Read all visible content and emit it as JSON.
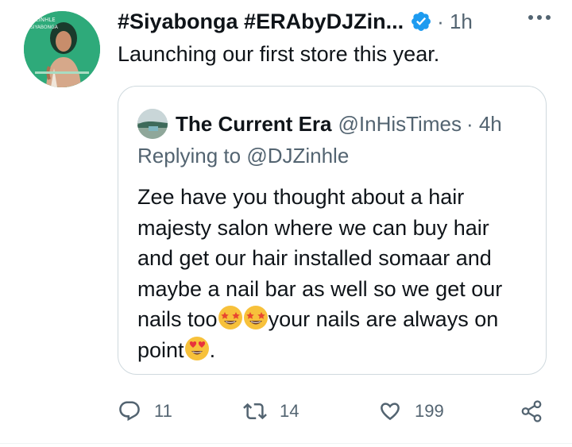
{
  "author": {
    "display_name": "#Siyabonga #ERAbyDJZin...",
    "time": "· 1h",
    "avatar_text_top": "ZINHLE",
    "avatar_text_sub": "SIYABONGA"
  },
  "tweet": {
    "text": "Launching our first store this year."
  },
  "quoted": {
    "display_name": "The Current Era",
    "handle": "@InHisTimes",
    "time": "· 4h",
    "replying_label": "Replying to",
    "replying_to": "@DJZinhle",
    "lines": [
      "Zee have you thought about a hair",
      "majesty salon where we can buy hair",
      "and get our hair installed somaar and",
      "maybe a nail bar as well so we get our"
    ],
    "line5_a": "nails too",
    "line5_b": "your nails are always on",
    "line6_a": "point",
    "line6_b": "."
  },
  "actions": {
    "replies": "11",
    "retweets": "14",
    "likes": "199"
  },
  "colors": {
    "verified": "#1d9bf0",
    "muted": "#536471",
    "border": "#cfd9de",
    "avatar_bg": "#2eaa7a"
  },
  "icons": [
    "verified-badge-icon",
    "more-icon",
    "reply-icon",
    "retweet-icon",
    "like-icon",
    "share-icon",
    "star-struck-emoji",
    "heart-eyes-emoji"
  ]
}
